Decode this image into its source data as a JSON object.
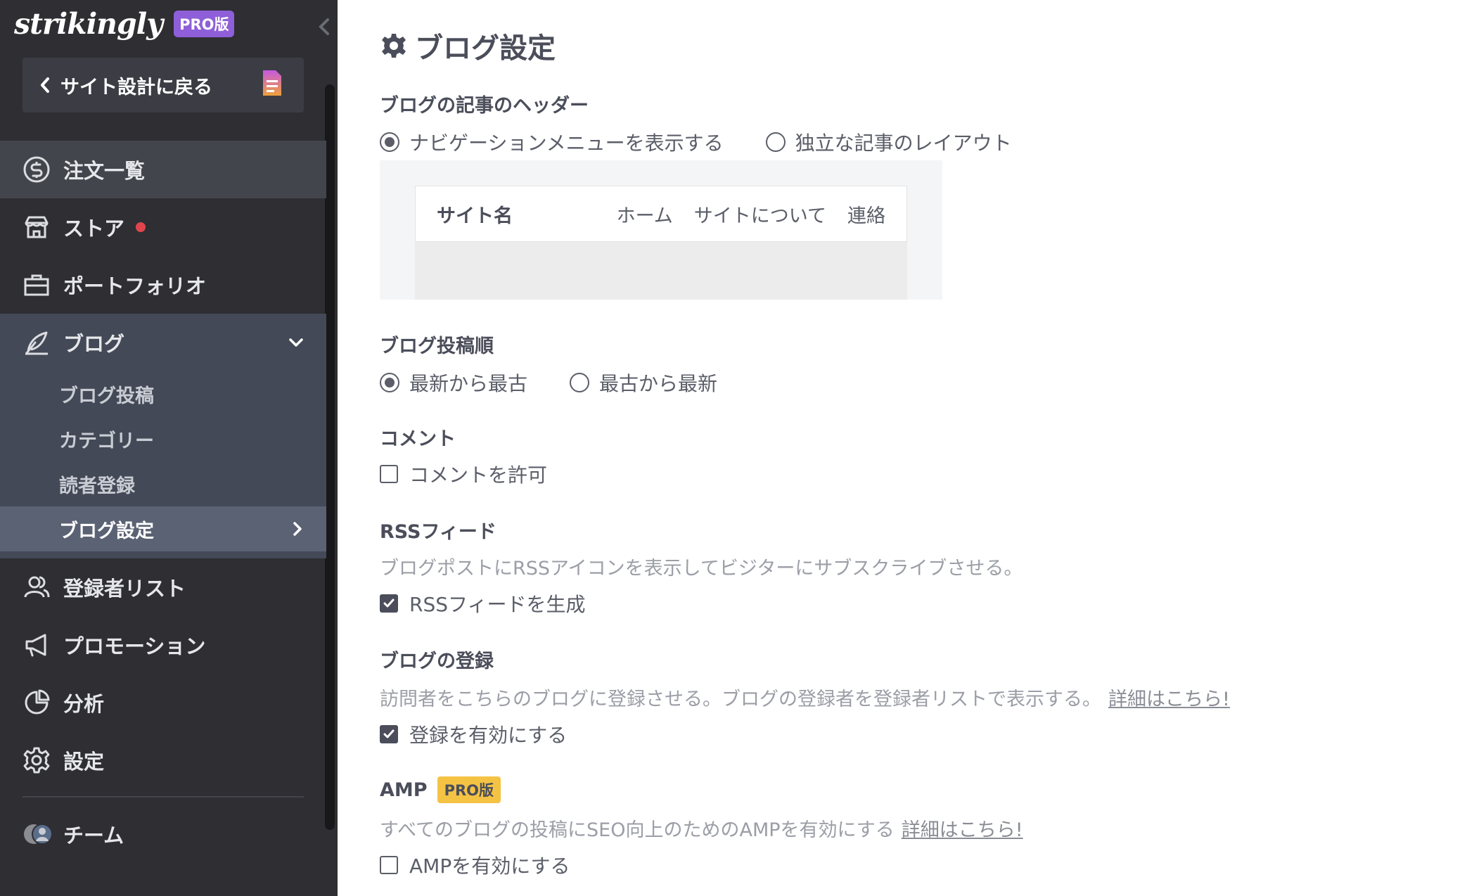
{
  "sidebar": {
    "logo": "strikingly",
    "pro_badge": "PRO版",
    "back_label": "サイト設計に戻る",
    "items": [
      {
        "label": "注文一覧"
      },
      {
        "label": "ストア"
      },
      {
        "label": "ポートフォリオ"
      },
      {
        "label": "ブログ"
      },
      {
        "label": "登録者リスト"
      },
      {
        "label": "プロモーション"
      },
      {
        "label": "分析"
      },
      {
        "label": "設定"
      },
      {
        "label": "チーム"
      }
    ],
    "blog_sub": [
      {
        "label": "ブログ投稿"
      },
      {
        "label": "カテゴリー"
      },
      {
        "label": "読者登録"
      },
      {
        "label": "ブログ設定"
      }
    ]
  },
  "main": {
    "title": "ブログ設定",
    "header_section": {
      "title": "ブログの記事のヘッダー",
      "option1": "ナビゲーションメニューを表示する",
      "option2": "独立な記事のレイアウト",
      "preview": {
        "site_name": "サイト名",
        "links": [
          "ホーム",
          "サイトについて",
          "連絡"
        ]
      }
    },
    "order_section": {
      "title": "ブログ投稿順",
      "option1": "最新から最古",
      "option2": "最古から最新"
    },
    "comment_section": {
      "title": "コメント",
      "checkbox": "コメントを許可"
    },
    "rss_section": {
      "title": "RSSフィード",
      "desc": "ブログポストにRSSアイコンを表示してビジターにサブスクライブさせる。",
      "checkbox": "RSSフィードを生成"
    },
    "subscribe_section": {
      "title": "ブログの登録",
      "desc": "訪問者をこちらのブログに登録させる。ブログの登録者を登録者リストで表示する。",
      "link": "詳細はこちら!",
      "checkbox": "登録を有効にする"
    },
    "amp_section": {
      "title": "AMP",
      "badge": "PRO版",
      "desc": "すべてのブログの投稿にSEO向上のためのAMPを有効にする",
      "link": "詳細はこちら!",
      "checkbox": "AMPを有効にする"
    }
  },
  "colors": {
    "sidebar_bg": "#2e2e33",
    "sidebar_active": "#43454d",
    "blog_group_bg": "#434957",
    "sub_current_bg": "#5a6273",
    "pro_purple": "#8e5fd8",
    "amp_yellow": "#f5c344",
    "notify_red": "#e0454d"
  }
}
